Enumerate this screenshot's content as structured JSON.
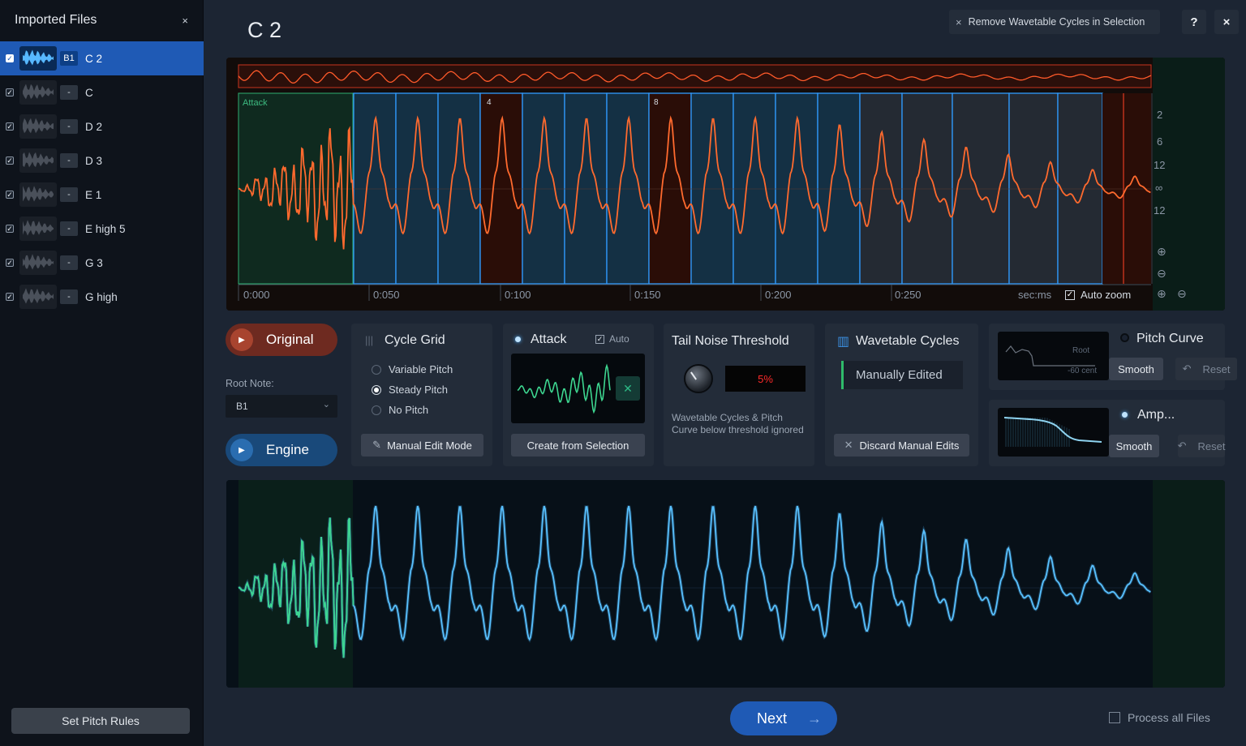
{
  "sidebar": {
    "title": "Imported Files",
    "close_icon": "×",
    "files": [
      {
        "badge": "B1",
        "name": "C 2",
        "checked": "✓",
        "selected": true
      },
      {
        "badge": "-",
        "name": "C",
        "checked": "✓",
        "selected": false
      },
      {
        "badge": "-",
        "name": "D 2",
        "checked": "✓",
        "selected": false
      },
      {
        "badge": "-",
        "name": "D 3",
        "checked": "✓",
        "selected": false
      },
      {
        "badge": "-",
        "name": "E 1",
        "checked": "✓",
        "selected": false
      },
      {
        "badge": "-",
        "name": "E high 5",
        "checked": "✓",
        "selected": false
      },
      {
        "badge": "-",
        "name": "G 3",
        "checked": "✓",
        "selected": false
      },
      {
        "badge": "-",
        "name": "G high",
        "checked": "✓",
        "selected": false
      }
    ],
    "set_pitch_rules": "Set Pitch Rules"
  },
  "header": {
    "title": "C 2",
    "remove_cycles": "Remove Wavetable Cycles in Selection",
    "remove_icon": "×",
    "help": "?",
    "close": "×"
  },
  "editor": {
    "attack_label": "Attack",
    "cycle_markers": [
      "4",
      "8"
    ],
    "scale": [
      "2",
      "6",
      "12",
      "∞",
      "12"
    ],
    "times": [
      "0:000",
      "0:050",
      "0:100",
      "0:150",
      "0:200",
      "0:250"
    ],
    "unit": "sec:ms",
    "auto_zoom": "Auto zoom",
    "auto_zoom_check": "✓",
    "zoom_in_icon": "⊕",
    "zoom_out_icon": "⊖"
  },
  "controls": {
    "original": "Original",
    "engine": "Engine",
    "play_icon": "▶",
    "root_note_label": "Root Note:",
    "root_note_value": "B1",
    "chevron": "⌄",
    "cycle_grid": {
      "title": "Cycle Grid",
      "icon": "|||",
      "options": [
        "Variable Pitch",
        "Steady Pitch",
        "No Pitch"
      ],
      "selected": "Steady Pitch",
      "manual_edit": "Manual Edit Mode",
      "pencil_icon": "✎"
    },
    "attack": {
      "title": "Attack",
      "auto": "Auto",
      "auto_check": "✓",
      "create": "Create from Selection",
      "x_icon": "✕"
    },
    "tail": {
      "title": "Tail Noise Threshold",
      "value": "5%",
      "description": "Wavetable Cycles & Pitch Curve below threshold ignored"
    },
    "wavetable": {
      "title": "Wavetable Cycles",
      "icon": "▥",
      "status": "Manually Edited",
      "discard": "Discard Manual Edits",
      "x_icon": "✕"
    },
    "pitch_curve": {
      "title": "Pitch Curve",
      "root": "Root",
      "cent": "-60 cent",
      "smooth": "Smooth",
      "reset": "Reset",
      "reset_icon": "↶"
    },
    "amp": {
      "title": "Amp...",
      "smooth": "Smooth",
      "reset": "Reset",
      "reset_icon": "↶"
    }
  },
  "footer": {
    "next": "Next",
    "next_arrow": "→",
    "process_all": "Process all Files"
  },
  "colors": {
    "accent": "#1f5ab5",
    "original_wave": "#ff6a2e",
    "attack_green": "#3dd690",
    "engine_blue": "#4fb8ff",
    "threshold_red": "#ff2a2a"
  }
}
